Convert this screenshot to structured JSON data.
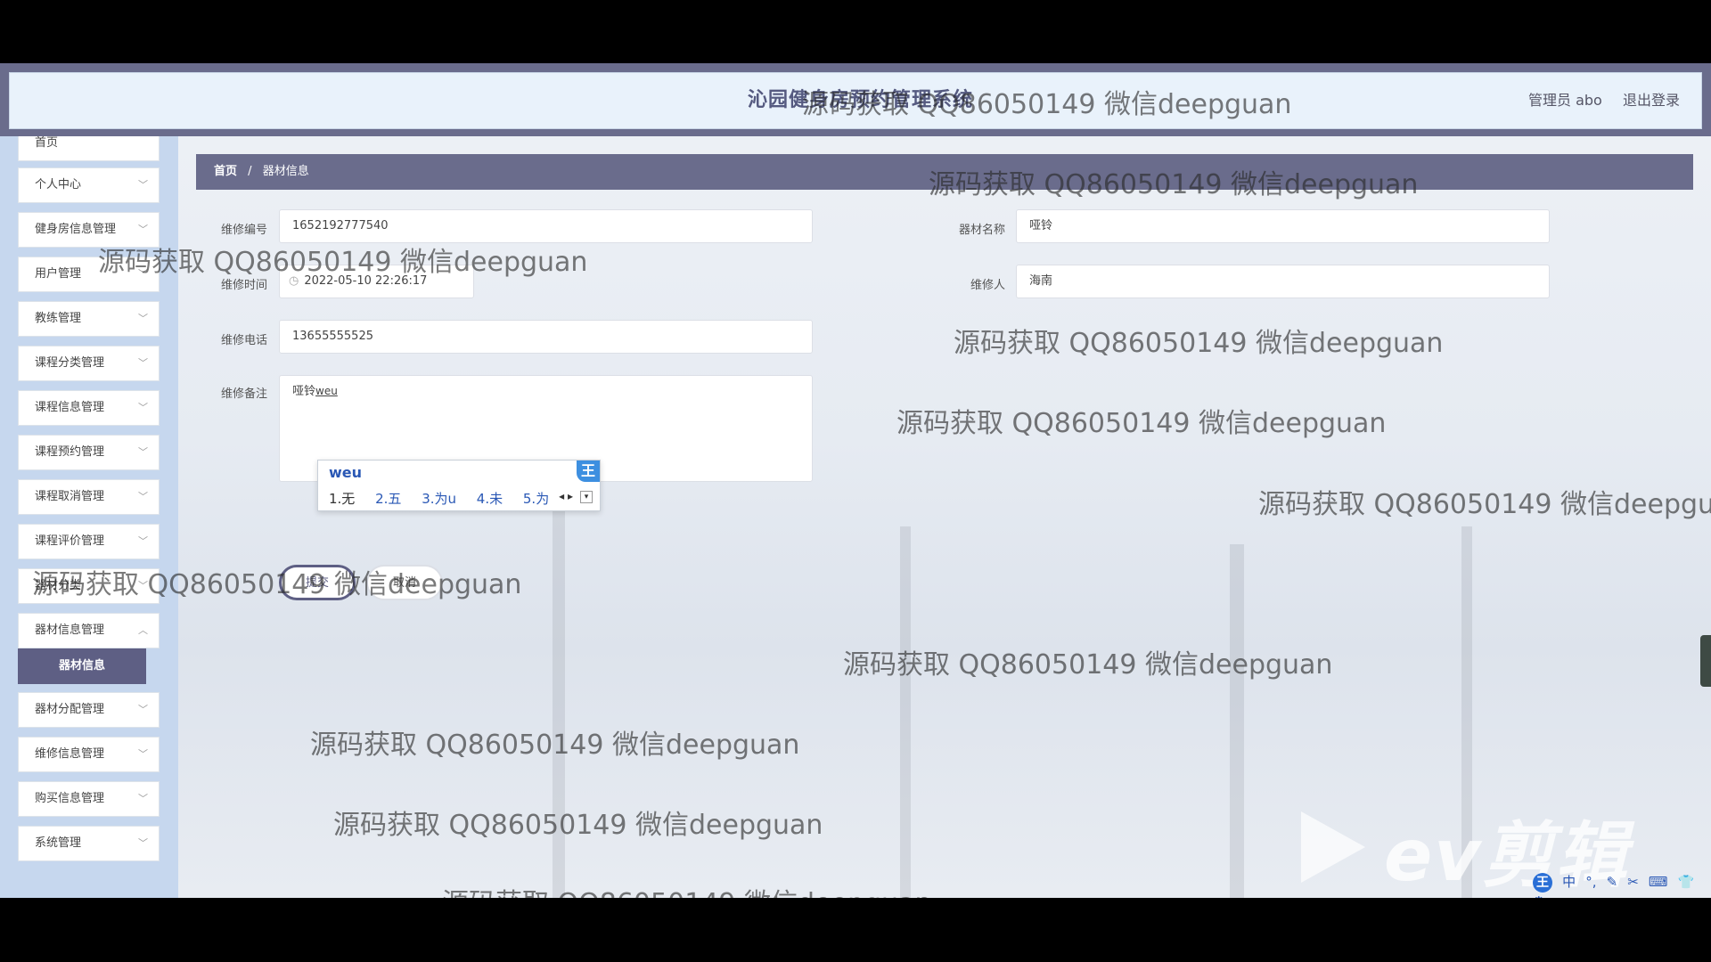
{
  "header": {
    "app_title": "沁园健身房预约管理系统",
    "user_label": "管理员 abo",
    "logout_label": "退出登录"
  },
  "sidebar": {
    "items": [
      {
        "label": "首页"
      },
      {
        "label": "个人中心"
      },
      {
        "label": "健身房信息管理"
      },
      {
        "label": "用户管理"
      },
      {
        "label": "教练管理"
      },
      {
        "label": "课程分类管理"
      },
      {
        "label": "课程信息管理"
      },
      {
        "label": "课程预约管理"
      },
      {
        "label": "课程取消管理"
      },
      {
        "label": "课程评价管理"
      },
      {
        "label": "器材分类"
      },
      {
        "label": "器材信息管理"
      },
      {
        "label": "器材分配管理"
      },
      {
        "label": "维修信息管理"
      },
      {
        "label": "购买信息管理"
      },
      {
        "label": "系统管理"
      }
    ],
    "active_sub": "器材信息"
  },
  "breadcrumb": {
    "home": "首页",
    "separator": "/",
    "current": "器材信息"
  },
  "form": {
    "repair_no_label": "维修编号",
    "repair_no_value": "1652192777540",
    "equipment_name_label": "器材名称",
    "equipment_name_value": "哑铃",
    "repair_time_label": "维修时间",
    "repair_time_value": "2022-05-10 22:26:17",
    "repairer_label": "维修人",
    "repairer_value": "海南",
    "repair_phone_label": "维修电话",
    "repair_phone_value": "13655555525",
    "remark_label": "维修备注",
    "remark_value": "哑铃",
    "remark_composing": "weu",
    "submit_label": "提交",
    "cancel_label": "取消"
  },
  "ime": {
    "composition": "weu",
    "candidates": [
      "1.无",
      "2.五",
      "3.为u",
      "4.未",
      "5.为"
    ],
    "logo": "王"
  },
  "watermark": {
    "text": "源码获取 QQ86050149 微信deepguan"
  },
  "video_overlay": {
    "brand": "ev剪辑"
  },
  "tray": {
    "logo": "王",
    "items": [
      "中",
      "°,",
      "✎",
      "✂",
      "⌨",
      "👕",
      "⚙"
    ]
  }
}
